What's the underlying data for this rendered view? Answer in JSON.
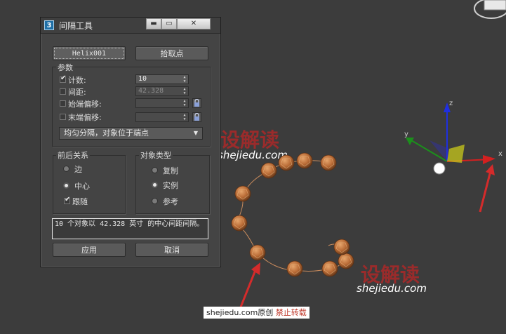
{
  "colors": {
    "accent_red": "#a42b2b",
    "panel_bg": "#444444",
    "viewport_bg": "#3c3c3c"
  },
  "dialog": {
    "app_icon": "3",
    "title": "间隔工具",
    "min_label": "▬",
    "max_label": "▭",
    "close_label": "✕",
    "path_button": "Helix001",
    "pick_button": "拾取点",
    "params_label": "参数",
    "count_label": "计数:",
    "count_value": "10",
    "count_checked": true,
    "spacing_label": "间距:",
    "spacing_value": "42.328",
    "spacing_checked": false,
    "start_offset_label": "始端偏移:",
    "start_offset_value": "",
    "start_offset_checked": false,
    "end_offset_label": "末端偏移:",
    "end_offset_value": "",
    "end_offset_checked": false,
    "distribution_selected": "均匀分隔，对象位于端点",
    "context_group_label": "前后关系",
    "context_options": [
      "边",
      "中心",
      "跟随"
    ],
    "context_selected": "中心",
    "follow_checked": true,
    "object_type_label": "对象类型",
    "object_type_options": [
      "复制",
      "实例",
      "参考"
    ],
    "object_type_selected": "实例",
    "status_text": "10 个对象以 42.328 英寸 的中心间距间隔。",
    "apply_button": "应用",
    "cancel_button": "取消"
  },
  "viewport": {
    "axes": {
      "x": "x",
      "y": "y",
      "z": "z"
    },
    "watermark_cn": "设解读",
    "watermark_url": "shejiedu.com",
    "footer_site": "shejiedu.com",
    "footer_original": "原创",
    "footer_warning": "禁止转载"
  }
}
